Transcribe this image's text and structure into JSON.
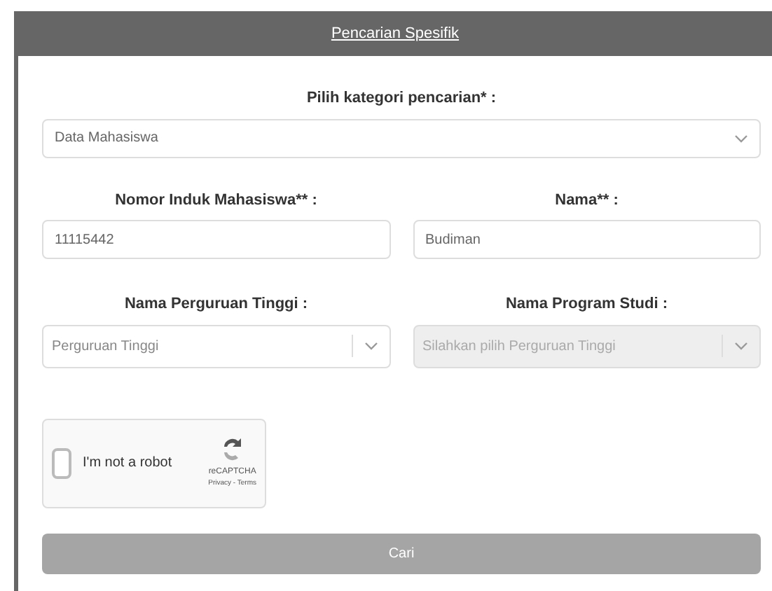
{
  "header": {
    "title": "Pencarian Spesifik"
  },
  "category": {
    "label": "Pilih kategori pencarian* :",
    "value": "Data Mahasiswa"
  },
  "fields": [
    {
      "kind": "input",
      "label": "Nomor Induk Mahasiswa** :",
      "value": "11115442",
      "disabled": false
    },
    {
      "kind": "input",
      "label": "Nama** :",
      "value": "Budiman",
      "disabled": false
    },
    {
      "kind": "select",
      "label": "Nama Perguruan Tinggi :",
      "placeholder": "Perguruan Tinggi",
      "disabled": false
    },
    {
      "kind": "select",
      "label": "Nama Program Studi :",
      "placeholder": "Silahkan pilih Perguruan Tinggi",
      "disabled": true
    }
  ],
  "captcha": {
    "label": "I'm not a robot",
    "checked": false,
    "brand": "reCAPTCHA",
    "links": "Privacy - Terms"
  },
  "submit": {
    "label": "Cari"
  }
}
